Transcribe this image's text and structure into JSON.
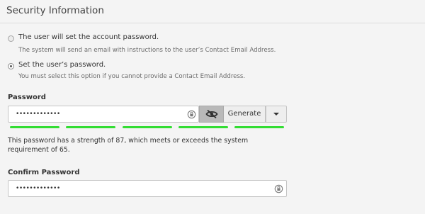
{
  "section": {
    "title": "Security Information"
  },
  "options": [
    {
      "label": "The user will set the account password.",
      "description": "The system will send an email with instructions to the user’s Contact Email Address.",
      "selected": false
    },
    {
      "label": "Set the user’s password.",
      "description": "You must select this option if you cannot provide a Contact Email Address.",
      "selected": true
    }
  ],
  "password": {
    "label": "Password",
    "value": "•••••••••••••",
    "generate_label": "Generate",
    "strength_segments": 5,
    "strength_filled": 5,
    "strength_color": "#33dd33",
    "strength_message": "This password has a strength of 87, which meets or exceeds the system requirement of 65."
  },
  "confirm_password": {
    "label": "Confirm Password",
    "value": "•••••••••••••"
  },
  "icons": {
    "field_icon": "password-manager-icon",
    "toggle_icon": "eye-slash-icon",
    "dropdown_icon": "caret-down-icon"
  }
}
